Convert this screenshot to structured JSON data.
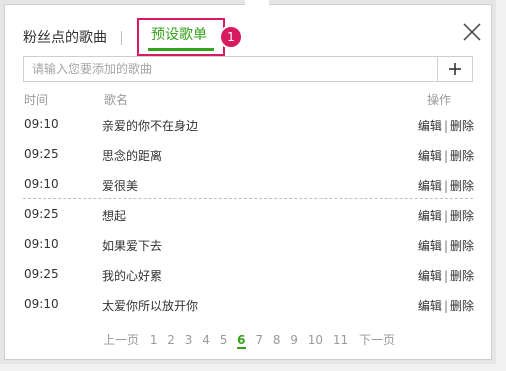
{
  "tabs": {
    "fans_label": "粉丝点的歌曲",
    "preset_label": "预设歌单",
    "badge": "1"
  },
  "search": {
    "placeholder": "请输入您要添加的歌曲",
    "add_icon": "plus-icon"
  },
  "table": {
    "headers": {
      "time": "时间",
      "name": "歌名",
      "ops": "操作"
    },
    "rows": [
      {
        "time": "09:10",
        "name": "亲爱的你不在身边",
        "edit": "编辑",
        "sep": "|",
        "delete": "删除"
      },
      {
        "time": "09:25",
        "name": "思念的距离",
        "edit": "编辑",
        "sep": "|",
        "delete": "删除"
      },
      {
        "time": "09:10",
        "name": "爱很美",
        "edit": "编辑",
        "sep": "|",
        "delete": "删除"
      },
      {
        "time": "09:25",
        "name": "想起",
        "edit": "编辑",
        "sep": "|",
        "delete": "删除"
      },
      {
        "time": "09:10",
        "name": "如果爱下去",
        "edit": "编辑",
        "sep": "|",
        "delete": "删除"
      },
      {
        "time": "09:25",
        "name": "我的心好累",
        "edit": "编辑",
        "sep": "|",
        "delete": "删除"
      },
      {
        "time": "09:10",
        "name": "太爱你所以放开你",
        "edit": "编辑",
        "sep": "|",
        "delete": "删除"
      }
    ]
  },
  "pagination": {
    "prev": "上一页",
    "pages": [
      "1",
      "2",
      "3",
      "4",
      "5",
      "6",
      "7",
      "8",
      "9",
      "10",
      "11"
    ],
    "current": "6",
    "next": "下一页"
  },
  "colors": {
    "accent": "#35a21b",
    "highlight": "#d81b60"
  }
}
